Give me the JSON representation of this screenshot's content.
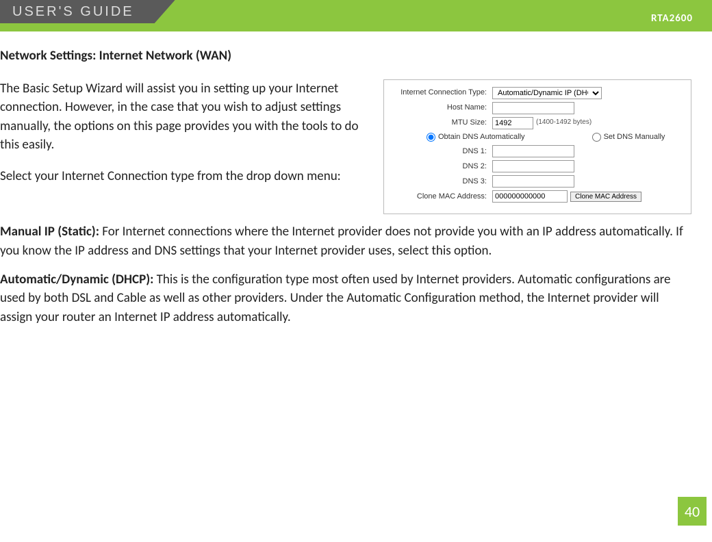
{
  "header": {
    "guide": "USER'S GUIDE",
    "model": "RTA2600"
  },
  "section_title": "Network Settings: Internet Network (WAN)",
  "intro": {
    "p1": "The Basic Setup Wizard will assist you in setting up your Internet connection. However, in the case that you wish to adjust settings manually, the options on this page provides you with the tools to do this easily.",
    "p2": "Select your Internet Connection type from the drop down menu:"
  },
  "panel": {
    "labels": {
      "conn_type": "Internet Connection Type:",
      "host_name": "Host Name:",
      "mtu": "MTU Size:",
      "mtu_hint": "(1400-1492 bytes)",
      "dns_auto": "Obtain DNS Automatically",
      "dns_manual": "Set DNS Manually",
      "dns1": "DNS 1:",
      "dns2": "DNS 2:",
      "dns3": "DNS 3:",
      "clone_mac": "Clone MAC Address:",
      "clone_btn": "Clone MAC Address"
    },
    "values": {
      "conn_type": "Automatic/Dynamic IP (DHCP)",
      "host_name": "",
      "mtu": "1492",
      "dns1": "",
      "dns2": "",
      "dns3": "",
      "clone_mac": "000000000000"
    }
  },
  "body": {
    "static_bold": "Manual IP (Static): ",
    "static_text": "For Internet connections where the Internet provider does not provide you with an IP address automatically. If you know the IP address and DNS settings that your Internet provider uses, select this option.",
    "dhcp_bold": "Automatic/Dynamic (DHCP): ",
    "dhcp_text": "This is the configuration type most often used by Internet providers. Automatic configurations are used by both DSL and Cable as well as other providers. Under the Automatic Configuration method, the Internet provider will assign your router an Internet IP address automatically."
  },
  "page_number": "40"
}
